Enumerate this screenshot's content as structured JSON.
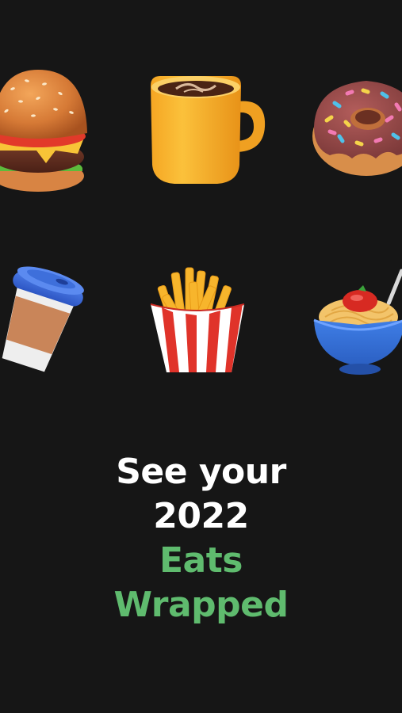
{
  "headline": {
    "line1": "See your",
    "line2": "2022",
    "line3": "Eats",
    "line4": "Wrapped"
  },
  "colors": {
    "background": "#161616",
    "headline_white": "#ffffff",
    "headline_green": "#5fbb6e"
  },
  "icons": [
    "burger-icon",
    "coffee-mug-icon",
    "donut-icon",
    "coffee-cup-icon",
    "fries-icon",
    "noodles-icon"
  ]
}
